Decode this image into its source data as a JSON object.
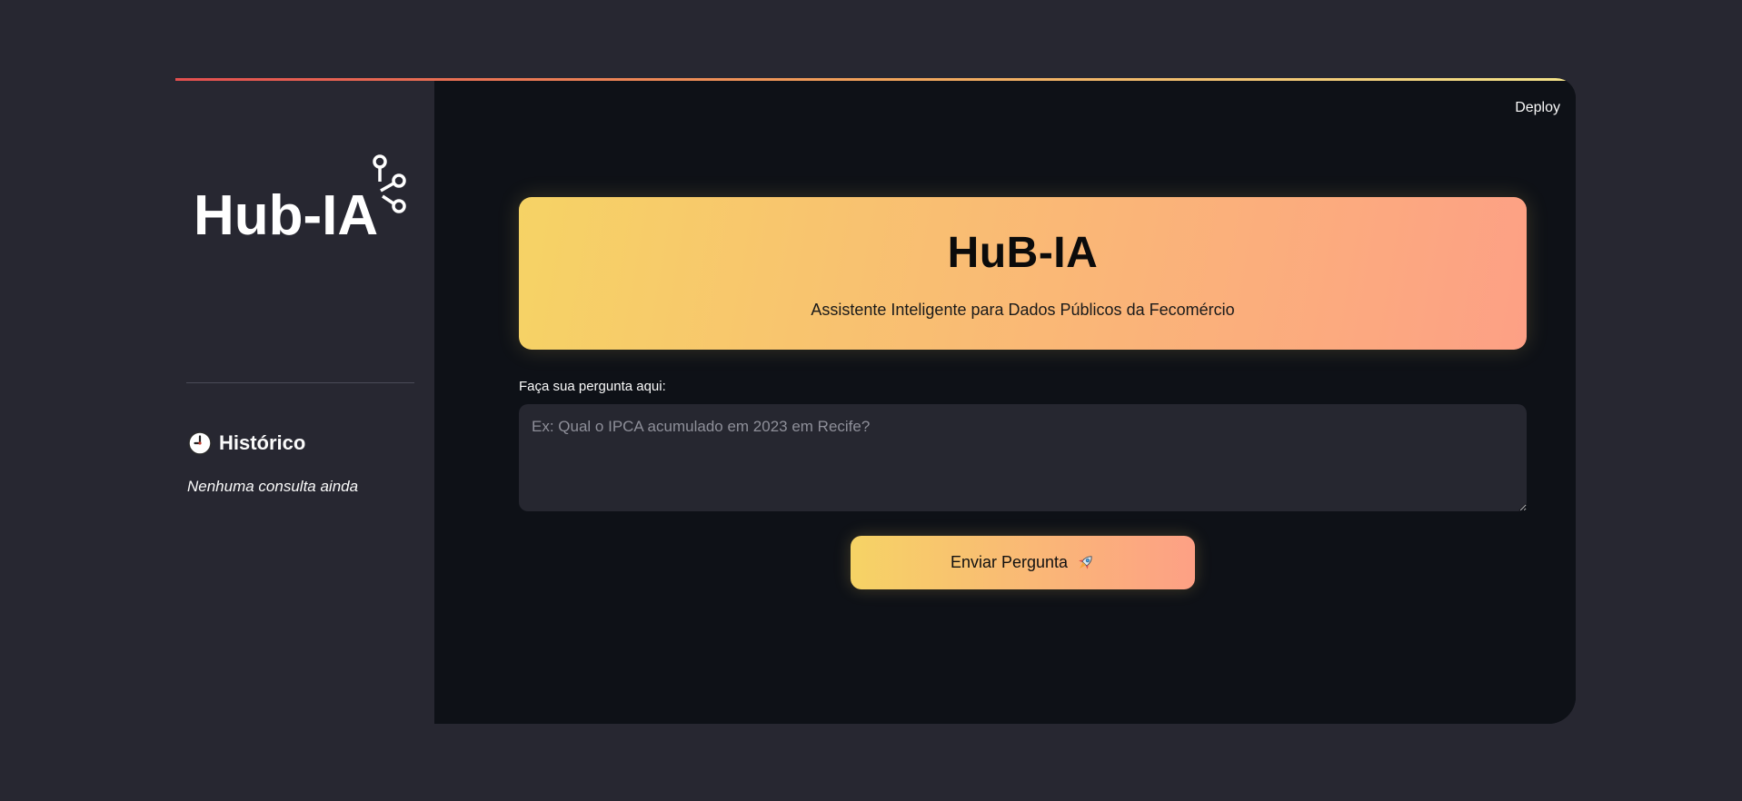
{
  "app": {
    "deploy_label": "Deploy",
    "accent_gradient": [
      "#f6d365",
      "#fda085"
    ],
    "top_gradient": [
      "#e34f4f",
      "#f0a25a",
      "#f3e38a"
    ]
  },
  "sidebar": {
    "logo_text": "Hub-IA",
    "history_icon": "clock-icon",
    "history_title": "Histórico",
    "history_empty": "Nenhuma consulta ainda"
  },
  "hero": {
    "title": "HuB-IA",
    "subtitle": "Assistente Inteligente para Dados Públicos da Fecomércio"
  },
  "form": {
    "label": "Faça sua pergunta aqui:",
    "placeholder": "Ex: Qual o IPCA acumulado em 2023 em Recife?",
    "value": "",
    "submit_label": "Enviar Pergunta",
    "submit_icon": "rocket-icon"
  }
}
